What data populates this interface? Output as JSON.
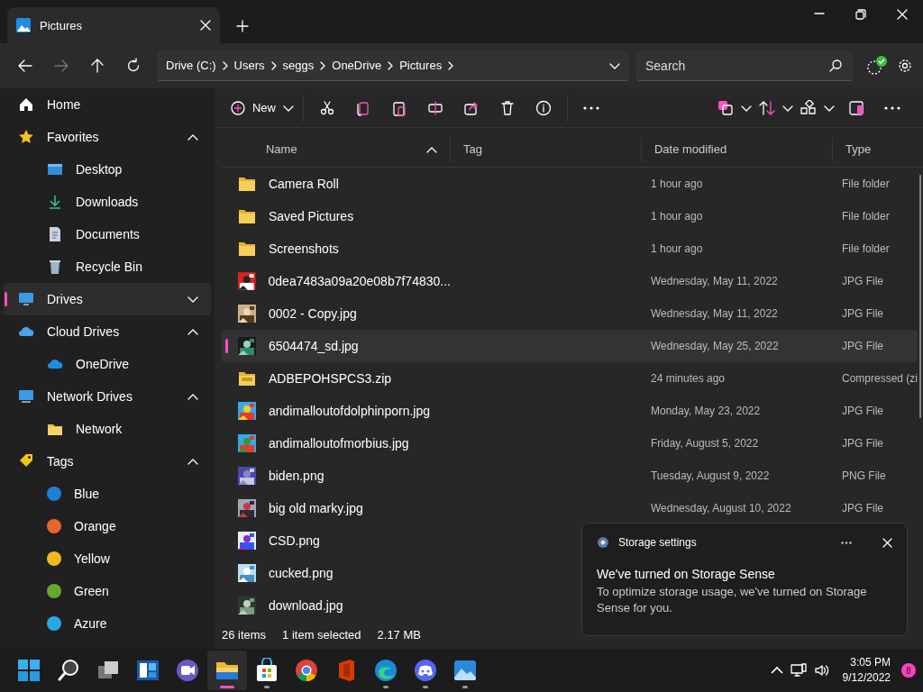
{
  "window": {
    "tab_title": "Pictures"
  },
  "address": {
    "crumbs": [
      "Drive (C:)",
      "Users",
      "seggs",
      "OneDrive",
      "Pictures"
    ],
    "search": {
      "placeholder": "Search"
    }
  },
  "sidebar": {
    "items": [
      {
        "label": "Home",
        "selected": false
      },
      {
        "label": "Favorites",
        "selected": false,
        "expanded": true,
        "children": [
          {
            "label": "Desktop",
            "selected": false
          },
          {
            "label": "Downloads",
            "selected": false
          },
          {
            "label": "Documents",
            "selected": false
          },
          {
            "label": "Recycle Bin",
            "selected": false
          }
        ]
      },
      {
        "label": "Drives",
        "selected": true,
        "expanded": false
      },
      {
        "label": "Cloud Drives",
        "selected": false,
        "expanded": true,
        "children": [
          {
            "label": "OneDrive",
            "selected": false
          }
        ]
      },
      {
        "label": "Network Drives",
        "selected": false,
        "expanded": true,
        "children": [
          {
            "label": "Network",
            "selected": false
          }
        ]
      },
      {
        "label": "Tags",
        "selected": false,
        "expanded": true,
        "children": [
          {
            "label": "Blue",
            "selected": false,
            "color": "#1e7fd6"
          },
          {
            "label": "Orange",
            "selected": false,
            "color": "#e3662a"
          },
          {
            "label": "Yellow",
            "selected": false,
            "color": "#f2b820"
          },
          {
            "label": "Green",
            "selected": false,
            "color": "#67a930"
          },
          {
            "label": "Azure",
            "selected": false,
            "color": "#2aa8e3"
          }
        ]
      }
    ]
  },
  "toolbar": {
    "new_label": "New"
  },
  "table": {
    "columns": [
      "Name",
      "Tag",
      "Date modified",
      "Type"
    ],
    "rows": [
      {
        "name": "Camera Roll",
        "kind": "folder",
        "date": "1 hour ago",
        "type": "File folder",
        "selected": false
      },
      {
        "name": "Saved Pictures",
        "kind": "folder",
        "date": "1 hour ago",
        "type": "File folder",
        "selected": false
      },
      {
        "name": "Screenshots",
        "kind": "folder",
        "date": "1 hour ago",
        "type": "File folder",
        "selected": false
      },
      {
        "name": "0dea7483a09a20e08b7f74830...",
        "date": "Wednesday, May 11, 2022",
        "type": "JPG File",
        "selected": false
      },
      {
        "name": "0002 - Copy.jpg",
        "date": "Wednesday, May 11, 2022",
        "type": "JPG File",
        "selected": false
      },
      {
        "name": "6504474_sd.jpg",
        "date": "Wednesday, May 25, 2022",
        "type": "JPG File",
        "selected": true
      },
      {
        "name": "ADBEPOHSPCS3.zip",
        "kind": "zip",
        "date": "24 minutes ago",
        "type": "Compressed (zi",
        "selected": false
      },
      {
        "name": "andimalloutofdolphinporn.jpg",
        "date": "Monday, May 23, 2022",
        "type": "JPG File",
        "selected": false
      },
      {
        "name": "andimalloutofmorbius.jpg",
        "date": "Friday, August 5, 2022",
        "type": "JPG File",
        "selected": false
      },
      {
        "name": "biden.png",
        "date": "Tuesday, August 9, 2022",
        "type": "PNG File",
        "selected": false
      },
      {
        "name": "big old marky.jpg",
        "date": "Wednesday, August 10, 2022",
        "type": "JPG File",
        "selected": false
      },
      {
        "name": "CSD.png",
        "selected": false
      },
      {
        "name": "cucked.png",
        "selected": false
      },
      {
        "name": "download.jpg",
        "selected": false
      }
    ]
  },
  "status_bar": {
    "count": "26 items",
    "selection": "1 item selected",
    "size": "2.17 MB"
  },
  "notification": {
    "app": "Storage settings",
    "title": "We've turned on Storage Sense",
    "body": "To optimize storage usage, we've turned on Storage Sense for you."
  },
  "taskbar": {
    "apps": [
      {
        "running": false,
        "active": false
      },
      {
        "running": false,
        "active": false
      },
      {
        "running": false,
        "active": false
      },
      {
        "running": false,
        "active": false
      },
      {
        "running": false,
        "active": false
      },
      {
        "running": true,
        "active": true
      },
      {
        "running": true,
        "active": false
      },
      {
        "running": false,
        "active": false
      },
      {
        "running": false,
        "active": false
      },
      {
        "running": true,
        "active": false
      },
      {
        "running": true,
        "active": false
      },
      {
        "running": true,
        "active": false
      }
    ],
    "time": "3:05 PM",
    "date": "9/12/2022",
    "badge": "8"
  }
}
